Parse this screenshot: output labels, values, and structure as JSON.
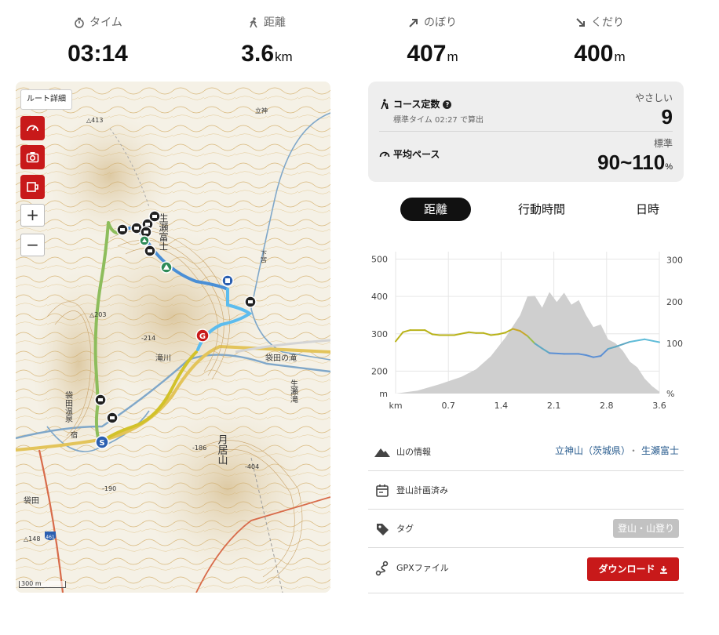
{
  "stats": [
    {
      "icon": "stopwatch-icon",
      "label": "タイム",
      "value": "03:14",
      "unit": ""
    },
    {
      "icon": "walker-icon",
      "label": "距離",
      "value": "3.6",
      "unit": "km"
    },
    {
      "icon": "arrow-up-right-icon",
      "label": "のぼり",
      "value": "407",
      "unit": "m"
    },
    {
      "icon": "arrow-down-right-icon",
      "label": "くだり",
      "value": "400",
      "unit": "m"
    }
  ],
  "map": {
    "route_detail_label": "ルート詳細",
    "buttons": [
      "speedometer-icon",
      "camera-icon",
      "memo-icon"
    ],
    "zoom_in": "+",
    "zoom_out": "−",
    "scale_label": "300 m",
    "place_labels": [
      "生瀬富士",
      "月居山",
      "袋田の滝",
      "生瀬滝",
      "袋田温泉",
      "袋田",
      "滝川",
      "宿",
      "△203",
      "△413",
      "△148",
      "-214",
      "-404",
      "-190",
      "-186",
      "立神",
      "下宮",
      "461"
    ],
    "markers": {
      "start": "S",
      "goal": "G"
    }
  },
  "summary": {
    "course_label": "コース定数",
    "help": "?",
    "standard_time": "標準タイム 02:27 で算出",
    "difficulty_label": "やさしい",
    "difficulty_value": "9",
    "pace_label": "平均ペース",
    "pace_level": "標準",
    "pace_value": "90~110",
    "pace_unit": "%"
  },
  "tabs": [
    "距離",
    "行動時間",
    "日時"
  ],
  "active_tab": 0,
  "chart_data": {
    "type": "area",
    "x_ticks": [
      "km",
      "0.7",
      "1.4",
      "2.1",
      "2.8",
      "3.6"
    ],
    "left_axis": {
      "ticks": [
        "500",
        "400",
        "300",
        "200",
        "m"
      ],
      "range": [
        140,
        520
      ]
    },
    "right_axis": {
      "ticks": [
        "300",
        "200",
        "100",
        "%"
      ],
      "range": [
        -20,
        320
      ]
    },
    "x_range": [
      0,
      3.6
    ],
    "elevation": {
      "x": [
        0.0,
        0.3,
        0.6,
        0.9,
        1.1,
        1.3,
        1.5,
        1.7,
        1.8,
        1.9,
        2.0,
        2.1,
        2.2,
        2.3,
        2.4,
        2.5,
        2.6,
        2.7,
        2.8,
        2.9,
        3.0,
        3.1,
        3.2,
        3.3,
        3.4,
        3.5,
        3.6
      ],
      "y": [
        140,
        148,
        165,
        185,
        205,
        240,
        290,
        350,
        400,
        402,
        370,
        412,
        385,
        410,
        378,
        390,
        350,
        318,
        325,
        285,
        275,
        255,
        225,
        210,
        180,
        160,
        145
      ]
    },
    "pace": {
      "x": [
        0.0,
        0.1,
        0.2,
        0.4,
        0.5,
        0.6,
        0.8,
        1.0,
        1.1,
        1.2,
        1.3,
        1.4,
        1.5,
        1.6,
        1.7,
        1.8,
        1.9,
        2.0,
        2.1,
        2.3,
        2.5,
        2.6,
        2.7,
        2.8,
        2.9,
        3.0,
        3.2,
        3.4,
        3.6
      ],
      "y": [
        105,
        127,
        132,
        132,
        122,
        120,
        120,
        127,
        125,
        125,
        120,
        122,
        126,
        135,
        130,
        118,
        100,
        88,
        77,
        75,
        75,
        72,
        67,
        70,
        87,
        92,
        104,
        110,
        103
      ],
      "colors": [
        "#b9b31a",
        "#b9b31a",
        "#b9b31a",
        "#b9b31a",
        "#b9b31a",
        "#b9b31a",
        "#b9b31a",
        "#b9b31a",
        "#b9b31a",
        "#b9b31a",
        "#b9b31a",
        "#b9b31a",
        "#b9b31a",
        "#c9a72b",
        "#c9a72b",
        "#9cbd4a",
        "#5fa8c3",
        "#5fa8c3",
        "#5b8fd4",
        "#5b8fd4",
        "#5b8fd4",
        "#5b8fd4",
        "#5b8fd4",
        "#5b8fd4",
        "#5fa8c3",
        "#5fa8c3",
        "#5fbcd8",
        "#5fbcd8",
        "#5fbcd8"
      ]
    }
  },
  "info": {
    "mountain_label": "山の情報",
    "mountains": [
      "立神山（茨城県）",
      "生瀬富士"
    ],
    "plan_label": "登山計画済み",
    "tag_label": "タグ",
    "tag_value": "登山・山登り",
    "gpx_label": "GPXファイル",
    "download_label": "ダウンロード"
  },
  "colors": {
    "accent_red": "#c8191a",
    "link": "#2a5d8f"
  }
}
